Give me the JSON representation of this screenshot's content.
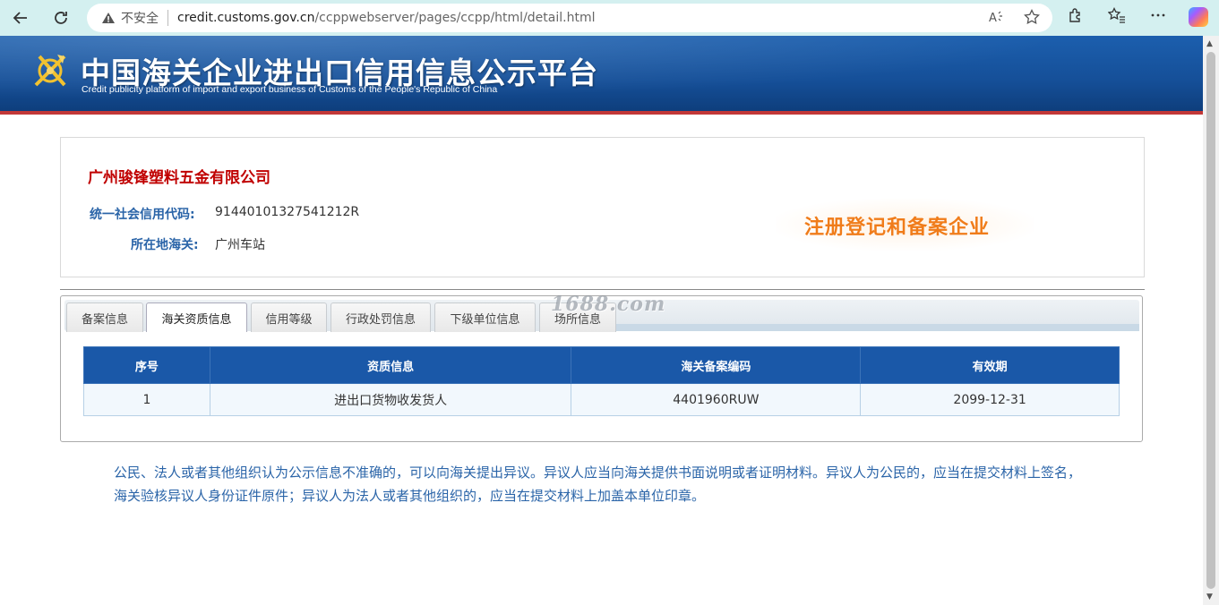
{
  "browser": {
    "insecure_label": "不安全",
    "url_host": "credit.customs.gov.cn",
    "url_path": "/ccppwebserver/pages/ccpp/html/detail.html",
    "icons": [
      "back-icon",
      "reload-icon",
      "warning-icon",
      "read-aloud-icon",
      "favorite-star-icon",
      "extensions-icon",
      "favorites-icon",
      "more-icon",
      "copilot-icon"
    ]
  },
  "header": {
    "title": "中国海关企业进出口信用信息公示平台",
    "subtitle": "Credit publicity platform of import and export business of Customs of the People's Republic of China"
  },
  "company": {
    "name": "广州骏锋塑料五金有限公司",
    "credit_code_label": "统一社会信用代码:",
    "credit_code": "91440101327541212R",
    "customs_label": "所在地海关:",
    "customs": "广州车站",
    "badge": "注册登记和备案企业"
  },
  "tabs": [
    {
      "label": "备案信息",
      "active": false
    },
    {
      "label": "海关资质信息",
      "active": true
    },
    {
      "label": "信用等级",
      "active": false
    },
    {
      "label": "行政处罚信息",
      "active": false
    },
    {
      "label": "下级单位信息",
      "active": false
    },
    {
      "label": "场所信息",
      "active": false
    }
  ],
  "watermark": "1688.com",
  "table": {
    "headers": [
      "序号",
      "资质信息",
      "海关备案编码",
      "有效期"
    ],
    "rows": [
      [
        "1",
        "进出口货物收发货人",
        "4401960RUW",
        "2099-12-31"
      ]
    ]
  },
  "notice": "公民、法人或者其他组织认为公示信息不准确的，可以向海关提出异议。异议人应当向海关提供书面说明或者证明材料。异议人为公民的，应当在提交材料上签名，海关验核异议人身份证件原件；异议人为法人或者其他组织的，应当在提交材料上加盖本单位印章。",
  "colors": {
    "header_blue": "#154f98",
    "company_red": "#c00000",
    "label_blue": "#2a64a8",
    "badge_orange": "#f07c1a",
    "table_header": "#1a58a8"
  }
}
